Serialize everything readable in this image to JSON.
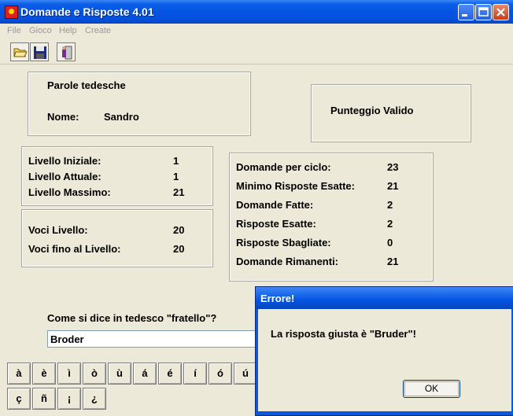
{
  "window": {
    "title": "Domande e Risposte 4.01"
  },
  "menu": [
    "File",
    "Gioco",
    "Help",
    "Create"
  ],
  "profile": {
    "subject": "Parole tedesche",
    "name_label": "Nome:",
    "name_value": "Sandro"
  },
  "score_status": "Punteggio Valido",
  "levels": [
    {
      "label": "Livello Iniziale:",
      "value": "1"
    },
    {
      "label": "Livello Attuale:",
      "value": "1"
    },
    {
      "label": "Livello Massimo:",
      "value": "21"
    }
  ],
  "entries": [
    {
      "label": "Voci Livello:",
      "value": "20"
    },
    {
      "label": "Voci fino al Livello:",
      "value": "20"
    }
  ],
  "stats": [
    {
      "label": "Domande per ciclo:",
      "value": "23"
    },
    {
      "label": "Minimo Risposte Esatte:",
      "value": "21"
    },
    {
      "label": "Domande Fatte:",
      "value": "2"
    },
    {
      "label": "Risposte Esatte:",
      "value": "2"
    },
    {
      "label": "Risposte Sbagliate:",
      "value": "0"
    },
    {
      "label": "Domande Rimanenti:",
      "value": "21"
    }
  ],
  "question": "Come si dice in tedesco \"fratello\"?",
  "answer": "Broder",
  "keys_row1": [
    "à",
    "è",
    "ì",
    "ò",
    "ù",
    "á",
    "é",
    "í",
    "ó",
    "ú"
  ],
  "keys_row2": [
    "ç",
    "ñ",
    "¡",
    "¿"
  ],
  "dialog": {
    "title": "Errore!",
    "message": "La risposta giusta è \"Bruder\"!",
    "ok_label": "OK"
  }
}
